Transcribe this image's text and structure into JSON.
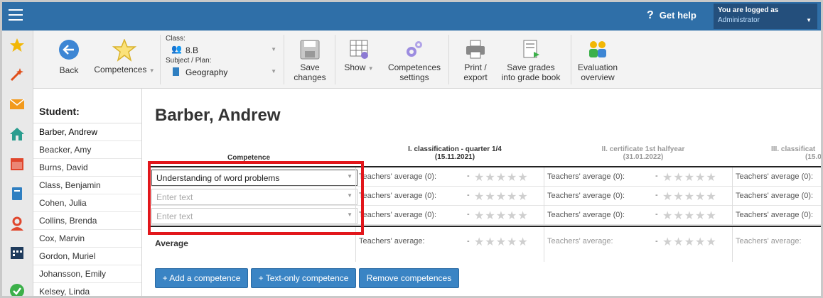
{
  "topbar": {
    "help": "Get help",
    "user_line1": "You are logged as",
    "user_line2": "Administrator"
  },
  "sidebar": {
    "icons": [
      "star-icon",
      "magic-wand-icon",
      "mail-icon",
      "home-icon",
      "calendar-icon",
      "book-icon",
      "person-icon",
      "timetable-icon",
      "check-icon"
    ]
  },
  "toolbar": {
    "back": "Back",
    "competences": "Competences",
    "class_label": "Class:",
    "class_value": "8.B",
    "subject_label": "Subject / Plan:",
    "subject_value": "Geography",
    "save_line1": "Save",
    "save_line2": "changes",
    "show": "Show",
    "comp_settings_line1": "Competences",
    "comp_settings_line2": "settings",
    "print_line1": "Print /",
    "print_line2": "export",
    "grades_line1": "Save grades",
    "grades_line2": "into grade book",
    "eval_line1": "Evaluation",
    "eval_line2": "overview"
  },
  "students": {
    "header": "Student:",
    "items": [
      "Barber, Andrew",
      "Beacker, Amy",
      "Burns, David",
      "Class, Benjamin",
      "Cohen, Julia",
      "Collins, Brenda",
      "Cox, Marvin",
      "Gordon, Muriel",
      "Johansson, Emily",
      "Kelsey, Linda"
    ],
    "selected": 0
  },
  "main": {
    "student_name": "Barber, Andrew",
    "competence_header": "Competence",
    "col1_line1": "I. classification - quarter 1/4",
    "col1_line2": "(15.11.2021)",
    "col2_line1": "II. certificate 1st halfyear",
    "col2_line2": "(31.01.2022)",
    "col3_line1": "III. classificat",
    "col3_line2": "(15.0",
    "rows": [
      {
        "value": "Understanding of word problems",
        "placeholder": ""
      },
      {
        "value": "",
        "placeholder": "Enter text"
      },
      {
        "value": "",
        "placeholder": "Enter text"
      }
    ],
    "teacher_avg": "Teachers' average (0):",
    "dash": "-",
    "average_label": "Average",
    "avg_teacher": "Teachers' average:",
    "buttons": {
      "add": "+ Add a competence",
      "text_only": "+ Text-only competence",
      "remove": "Remove competences"
    }
  }
}
